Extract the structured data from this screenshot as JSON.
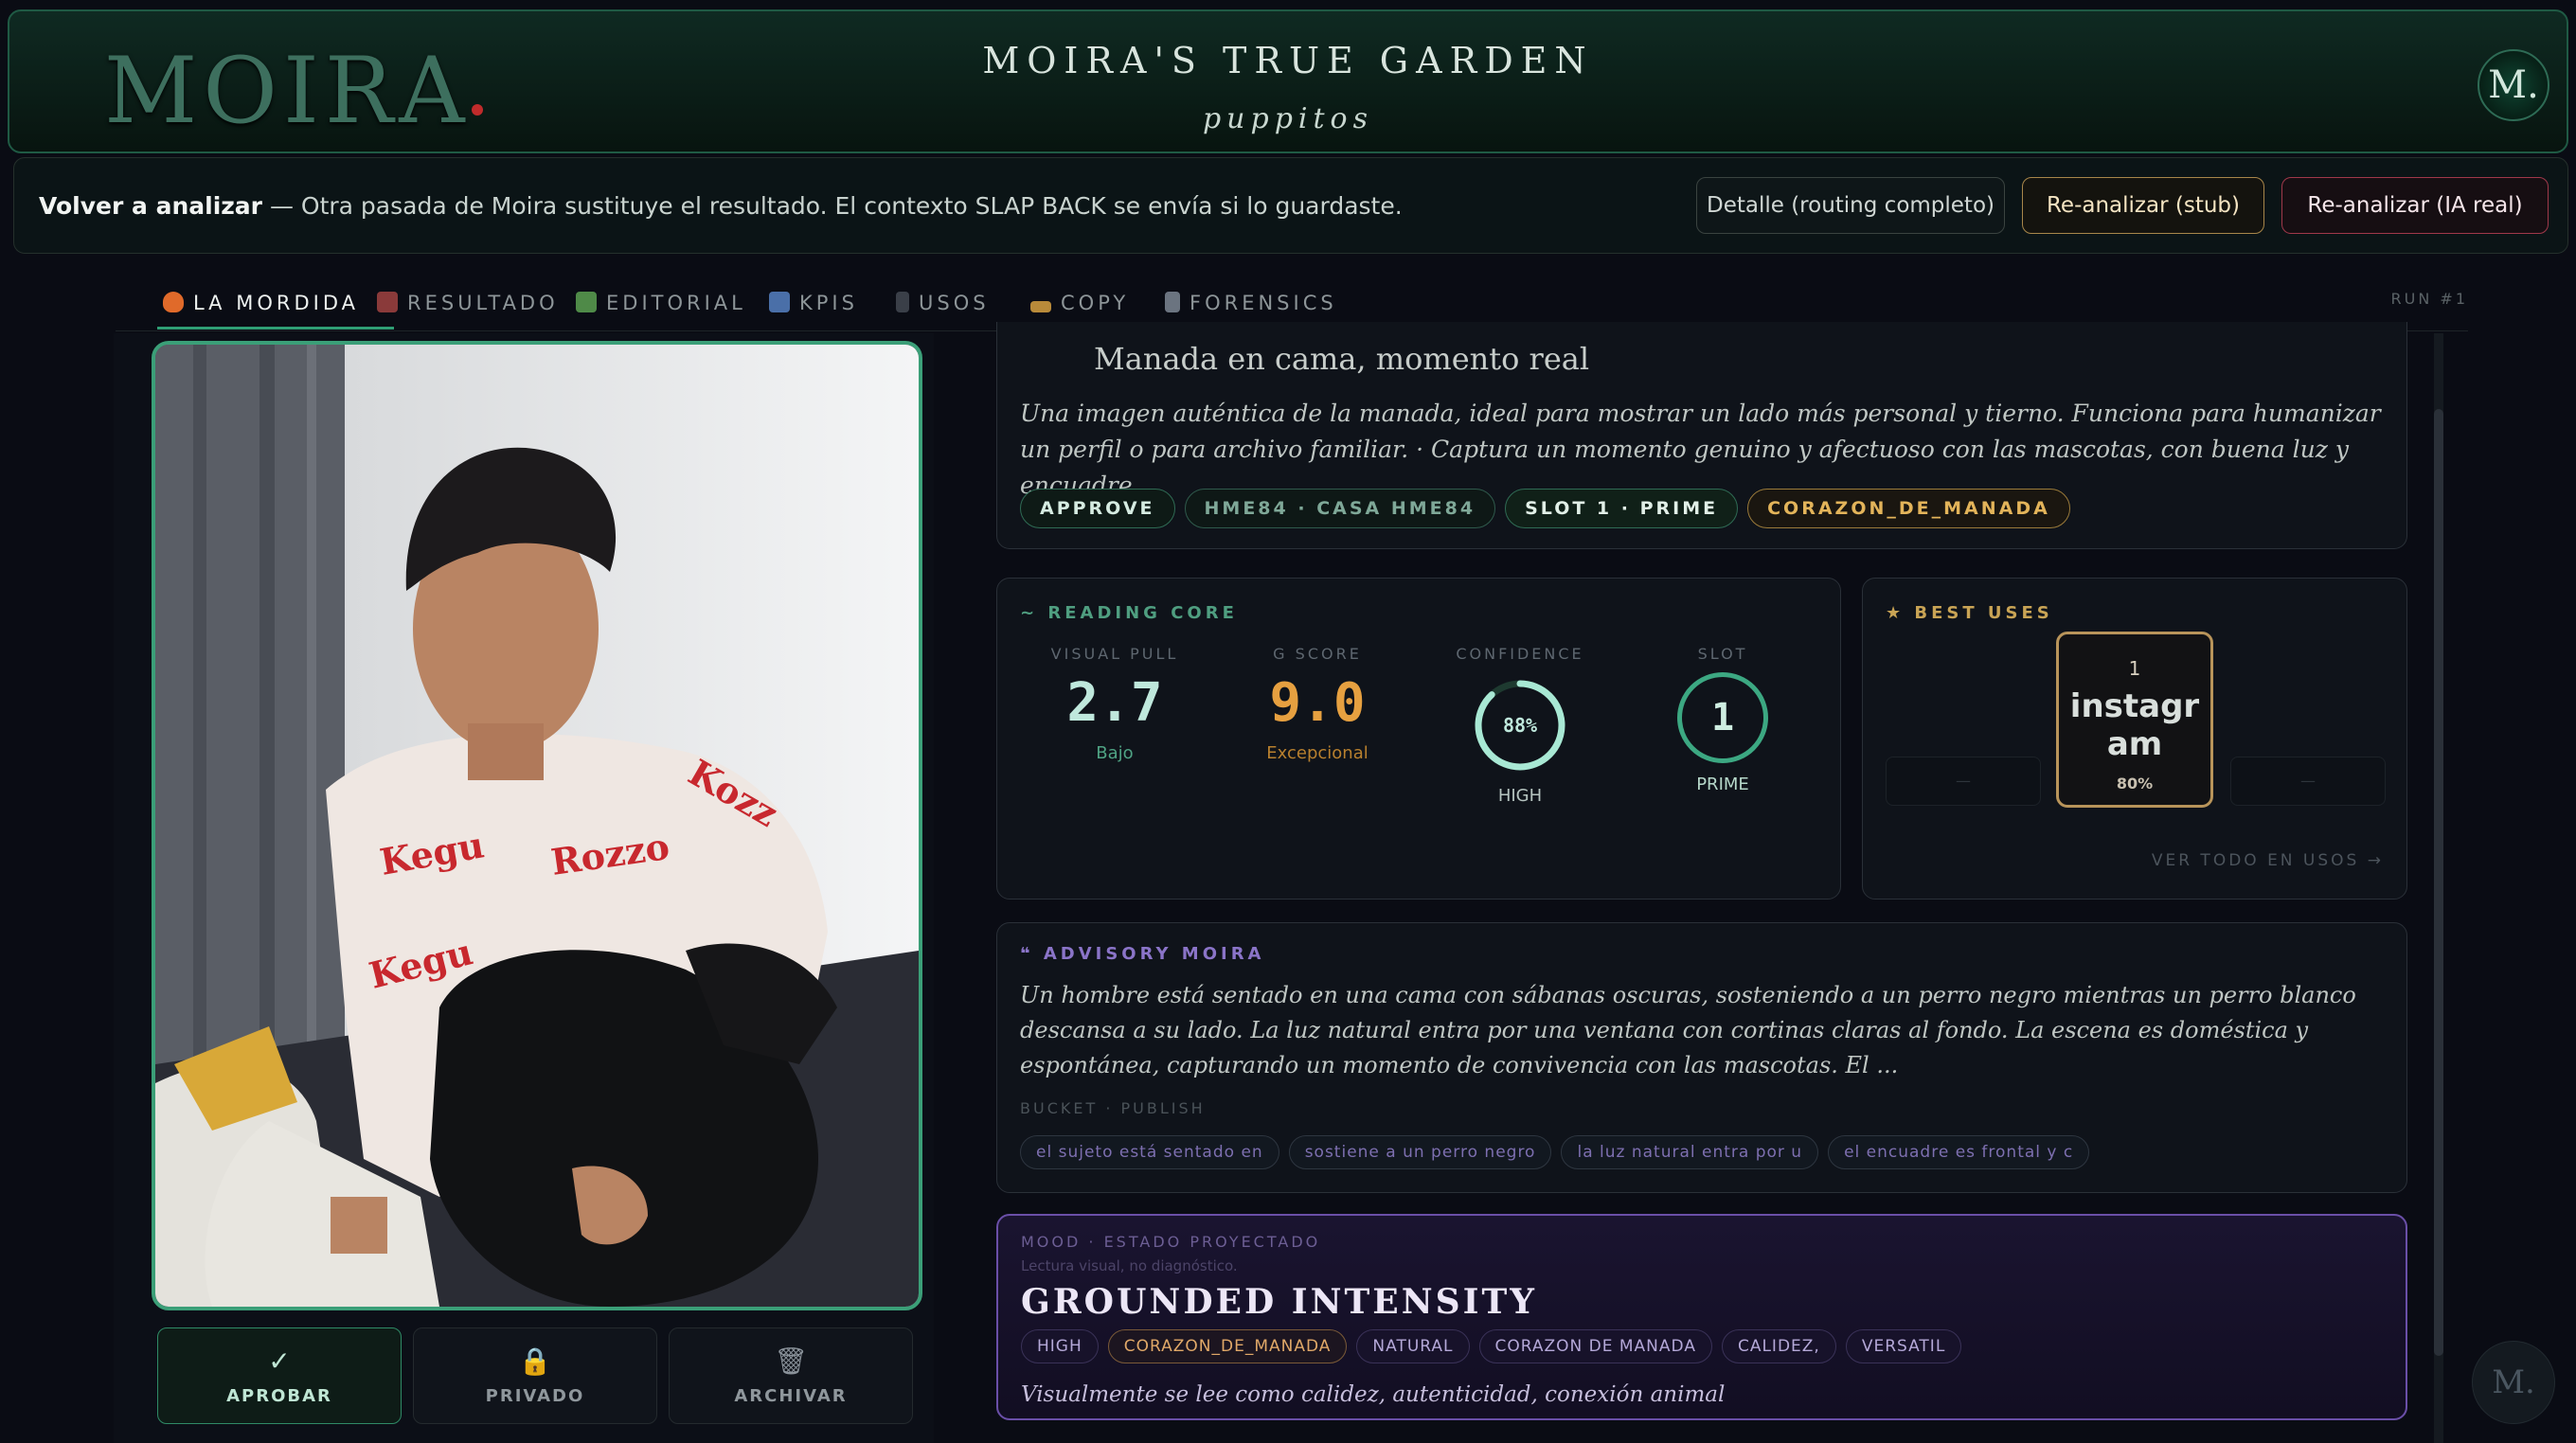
{
  "header": {
    "logo": "MOIRA",
    "title": "MOIRA'S TRUE GARDEN",
    "subtitle": "puppitos",
    "avatar_initial": "M."
  },
  "infobar": {
    "strong": "Volver a analizar",
    "text": " — Otra pasada de Moira sustituye el resultado. El contexto SLAP BACK se envía si lo guardaste.",
    "btn_detail": "Detalle (routing completo)",
    "btn_stub": "Re-analizar (stub)",
    "btn_real": "Re-analizar (IA real)"
  },
  "tabs": [
    {
      "label": "LA MORDIDA",
      "icon": "flame-icon"
    },
    {
      "label": "RESULTADO",
      "icon": "result-icon"
    },
    {
      "label": "EDITORIAL",
      "icon": "image-icon"
    },
    {
      "label": "KPIS",
      "icon": "bar-chart-icon"
    },
    {
      "label": "USOS",
      "icon": "phone-icon"
    },
    {
      "label": "COPY",
      "icon": "pen-icon"
    },
    {
      "label": "FORENSICS",
      "icon": "microscope-icon"
    }
  ],
  "run_tag": "RUN #1",
  "actions": {
    "approve": {
      "icon": "✓",
      "label": "APROBAR"
    },
    "private": {
      "icon": "🔒",
      "label": "PRIVADO"
    },
    "archive": {
      "icon": "🗑",
      "label": "ARCHIVAR"
    }
  },
  "summary": {
    "title": "Manada en cama, momento real",
    "description": "Una imagen auténtica de la manada, ideal para mostrar un lado más personal y tierno. Funciona para humanizar un perfil o para archivo familiar. · Captura un momento genuino y afectuoso con las mascotas, con buena luz y encuadre.",
    "pills": [
      "APPROVE",
      "HME84 · CASA HME84",
      "SLOT 1 · PRIME",
      "CORAZON_DE_MANADA"
    ]
  },
  "reading_core": {
    "label": "READING CORE",
    "visual_pull": {
      "label": "VISUAL PULL",
      "value": "2.7",
      "sub": "Bajo"
    },
    "g_score": {
      "label": "G SCORE",
      "value": "9.0",
      "sub": "Excepcional"
    },
    "confidence": {
      "label": "CONFIDENCE",
      "value": "88%",
      "sub": "HIGH",
      "fraction": 0.88
    },
    "slot": {
      "label": "SLOT",
      "value": "1",
      "sub": "PRIME"
    }
  },
  "best_uses": {
    "label": "BEST USES",
    "rank": "1",
    "name": "instagram",
    "pct": "80%",
    "left_placeholder": "—",
    "right_placeholder": "—",
    "link": "VER TODO EN USOS →"
  },
  "advisory": {
    "label": "ADVISORY MOIRA",
    "text": "Un hombre está sentado en una cama con sábanas oscuras, sosteniendo a un perro negro mientras un perro blanco descansa a su lado. La luz natural entra por una ventana con cortinas claras al fondo. La escena es doméstica y espontánea, capturando un momento de convivencia con las mascotas. El ...",
    "bucket": "BUCKET · PUBLISH",
    "chips": [
      "el sujeto está sentado en",
      "sostiene a un perro negro",
      "la luz natural entra por u",
      "el encuadre es frontal y c"
    ]
  },
  "mood": {
    "label": "MOOD · ESTADO PROYECTADO",
    "note": "Lectura visual, no diagnóstico.",
    "title": "GROUNDED INTENSITY",
    "chips": [
      "HIGH",
      "CORAZON_DE_MANADA",
      "NATURAL",
      "CORAZON DE MANADA",
      "CALIDEZ,",
      "VERSATIL"
    ],
    "caption": "Visualmente se lee como calidez, autenticidad, conexión animal"
  },
  "fab": "M."
}
